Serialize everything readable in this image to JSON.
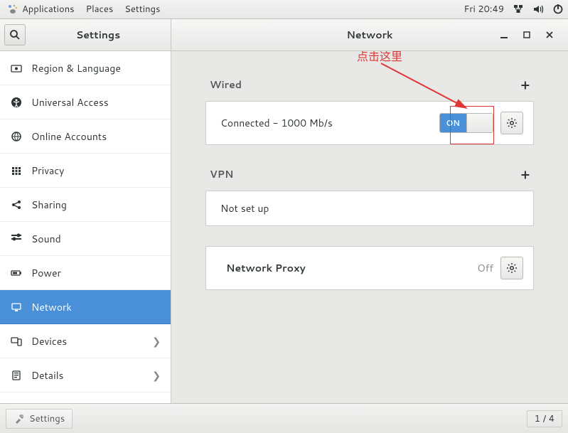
{
  "panel": {
    "applications": "Applications",
    "places": "Places",
    "settings": "Settings",
    "clock": "Fri 20:49"
  },
  "header": {
    "app_title": "Settings",
    "page_title": "Network"
  },
  "sidebar": {
    "items": [
      {
        "label": "Region & Language"
      },
      {
        "label": "Universal Access"
      },
      {
        "label": "Online Accounts"
      },
      {
        "label": "Privacy"
      },
      {
        "label": "Sharing"
      },
      {
        "label": "Sound"
      },
      {
        "label": "Power"
      },
      {
        "label": "Network",
        "selected": true
      },
      {
        "label": "Devices",
        "chevron": true
      },
      {
        "label": "Details",
        "chevron": true
      }
    ]
  },
  "network": {
    "wired_header": "Wired",
    "wired_status": "Connected - 1000 Mb/s",
    "wired_toggle_on": "ON",
    "vpn_header": "VPN",
    "vpn_status": "Not set up",
    "proxy_label": "Network Proxy",
    "proxy_state": "Off"
  },
  "annotation": {
    "label": "点击这里"
  },
  "taskbar": {
    "app": "Settings",
    "workspace": "1 / 4"
  }
}
